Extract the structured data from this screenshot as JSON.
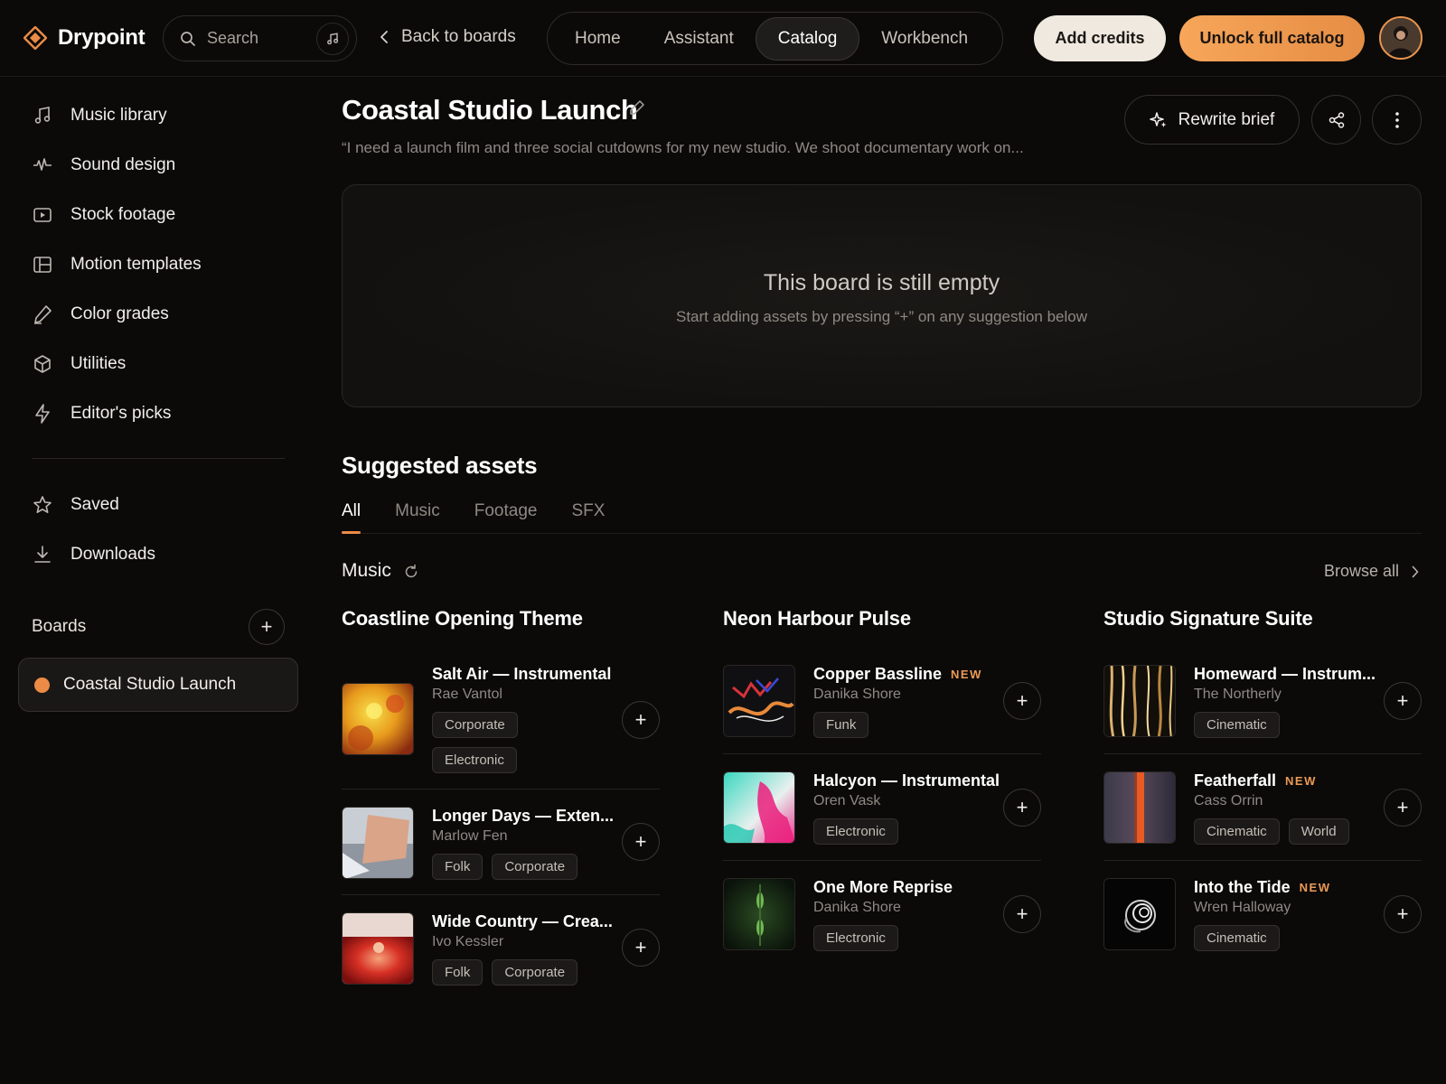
{
  "app": {
    "name": "Drypoint"
  },
  "search": {
    "placeholder": "Search"
  },
  "back": {
    "label": "Back to boards"
  },
  "nav": {
    "tabs": [
      "Home",
      "Assistant",
      "Catalog",
      "Workbench"
    ],
    "active": "Catalog"
  },
  "actions": {
    "add_credits": "Add credits",
    "unlock": "Unlock full catalog"
  },
  "sidebar": {
    "items": [
      {
        "label": "Music library",
        "icon": "music-note-icon"
      },
      {
        "label": "Sound design",
        "icon": "waveform-icon"
      },
      {
        "label": "Stock footage",
        "icon": "video-icon"
      },
      {
        "label": "Motion templates",
        "icon": "layout-icon"
      },
      {
        "label": "Color grades",
        "icon": "pen-icon"
      },
      {
        "label": "Utilities",
        "icon": "cube-icon"
      },
      {
        "label": "Editor's picks",
        "icon": "lightning-icon"
      }
    ],
    "secondary": [
      {
        "label": "Saved",
        "icon": "star-icon"
      },
      {
        "label": "Downloads",
        "icon": "download-icon"
      }
    ],
    "boards_label": "Boards",
    "active_board": "Coastal Studio Launch"
  },
  "board": {
    "title": "Coastal Studio Launch",
    "brief": "“I need a launch film and three social cutdowns for my new studio. We shoot documentary work on...",
    "rewrite_label": "Rewrite brief",
    "empty_title": "This board is still empty",
    "empty_sub": "Start adding assets by pressing “+” on any suggestion below"
  },
  "suggested": {
    "title": "Suggested assets",
    "tabs": [
      "All",
      "Music",
      "Footage",
      "SFX"
    ],
    "active_tab": "All",
    "section": "Music",
    "browse_all": "Browse all"
  },
  "columns": [
    {
      "title": "Coastline Opening Theme",
      "tracks": [
        {
          "name": "Salt Air — Instrumental",
          "artist": "Rae Vantol",
          "tags": [
            "Corporate",
            "Electronic"
          ],
          "new": ""
        },
        {
          "name": "Longer Days — Exten...",
          "artist": "Marlow Fen",
          "tags": [
            "Folk",
            "Corporate"
          ],
          "new": ""
        },
        {
          "name": "Wide Country — Crea...",
          "artist": "Ivo Kessler",
          "tags": [
            "Folk",
            "Corporate"
          ],
          "new": ""
        }
      ]
    },
    {
      "title": "Neon Harbour Pulse",
      "tracks": [
        {
          "name": "Copper Bassline",
          "artist": "Danika Shore",
          "tags": [
            "Funk"
          ],
          "new": "NEW"
        },
        {
          "name": "Halcyon — Instrumental",
          "artist": "Oren Vask",
          "tags": [
            "Electronic"
          ],
          "new": ""
        },
        {
          "name": "One More Reprise",
          "artist": "Danika Shore",
          "tags": [
            "Electronic"
          ],
          "new": ""
        }
      ]
    },
    {
      "title": "Studio Signature Suite",
      "tracks": [
        {
          "name": "Homeward — Instrum...",
          "artist": "The Northerly",
          "tags": [
            "Cinematic"
          ],
          "new": ""
        },
        {
          "name": "Featherfall",
          "artist": "Cass Orrin",
          "tags": [
            "Cinematic",
            "World"
          ],
          "new": "NEW"
        },
        {
          "name": "Into the Tide",
          "artist": "Wren Halloway",
          "tags": [
            "Cinematic"
          ],
          "new": "NEW"
        }
      ]
    }
  ],
  "colors": {
    "accent": "#ec8b46",
    "background": "#0b0a09",
    "credits_button": "#efe9df"
  }
}
